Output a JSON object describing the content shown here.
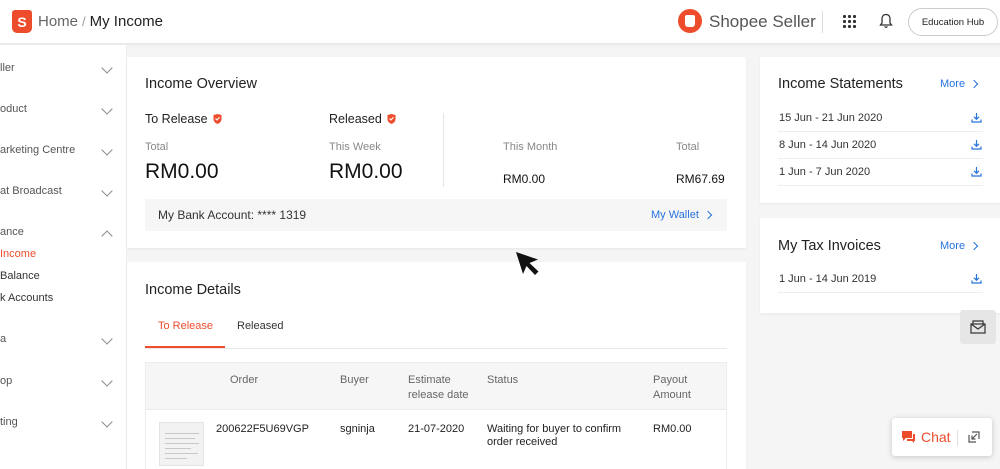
{
  "header": {
    "logo_letter": "S",
    "breadcrumb_home": "Home",
    "breadcrumb_sep": "/",
    "breadcrumb_current": "My Income",
    "brand": "Shopee Seller",
    "education_hub": "Education Hub"
  },
  "sidebar": {
    "items": [
      {
        "label": "ller",
        "expanded": false
      },
      {
        "label": "oduct",
        "expanded": false
      },
      {
        "label": "arketing Centre",
        "expanded": false
      },
      {
        "label": "at Broadcast",
        "expanded": false
      },
      {
        "label": "ance",
        "expanded": true
      },
      {
        "label": "a",
        "expanded": false
      },
      {
        "label": "op",
        "expanded": false
      },
      {
        "label": "ting",
        "expanded": false
      }
    ],
    "finance_sub": [
      {
        "label": "Income",
        "active": true
      },
      {
        "label": "Balance",
        "active": false
      },
      {
        "label": "k Accounts",
        "active": false
      }
    ]
  },
  "overview": {
    "title": "Income Overview",
    "to_release": {
      "label": "To Release",
      "sub": "Total",
      "amount": "RM0.00"
    },
    "released": {
      "label": "Released",
      "this_week": {
        "label": "This Week",
        "amount": "RM0.00"
      },
      "this_month": {
        "label": "This Month",
        "amount": "RM0.00"
      },
      "total": {
        "label": "Total",
        "amount": "RM67.69"
      }
    },
    "bank_account": "My Bank Account: **** 1319",
    "wallet_link": "My Wallet"
  },
  "details": {
    "title": "Income Details",
    "tabs": [
      {
        "label": "To Release",
        "active": true
      },
      {
        "label": "Released",
        "active": false
      }
    ],
    "columns": [
      "Order",
      "Buyer",
      "Estimate release date",
      "Status",
      "Payout Amount"
    ],
    "rows": [
      {
        "order": "200622F5U69VGP",
        "buyer": "sgninja",
        "release_date": "21-07-2020",
        "status": "Waiting for buyer to confirm order received",
        "payout": "RM0.00"
      }
    ]
  },
  "statements": {
    "title": "Income Statements",
    "more": "More",
    "items": [
      "15 Jun - 21 Jun 2020",
      "8 Jun - 14 Jun 2020",
      "1 Jun - 7 Jun 2020"
    ]
  },
  "tax": {
    "title": "My Tax Invoices",
    "more": "More",
    "items": [
      "1 Jun - 14 Jun 2019"
    ]
  },
  "chat": {
    "label": "Chat"
  },
  "colors": {
    "accent": "#ee4d2d",
    "link": "#2673dd"
  }
}
